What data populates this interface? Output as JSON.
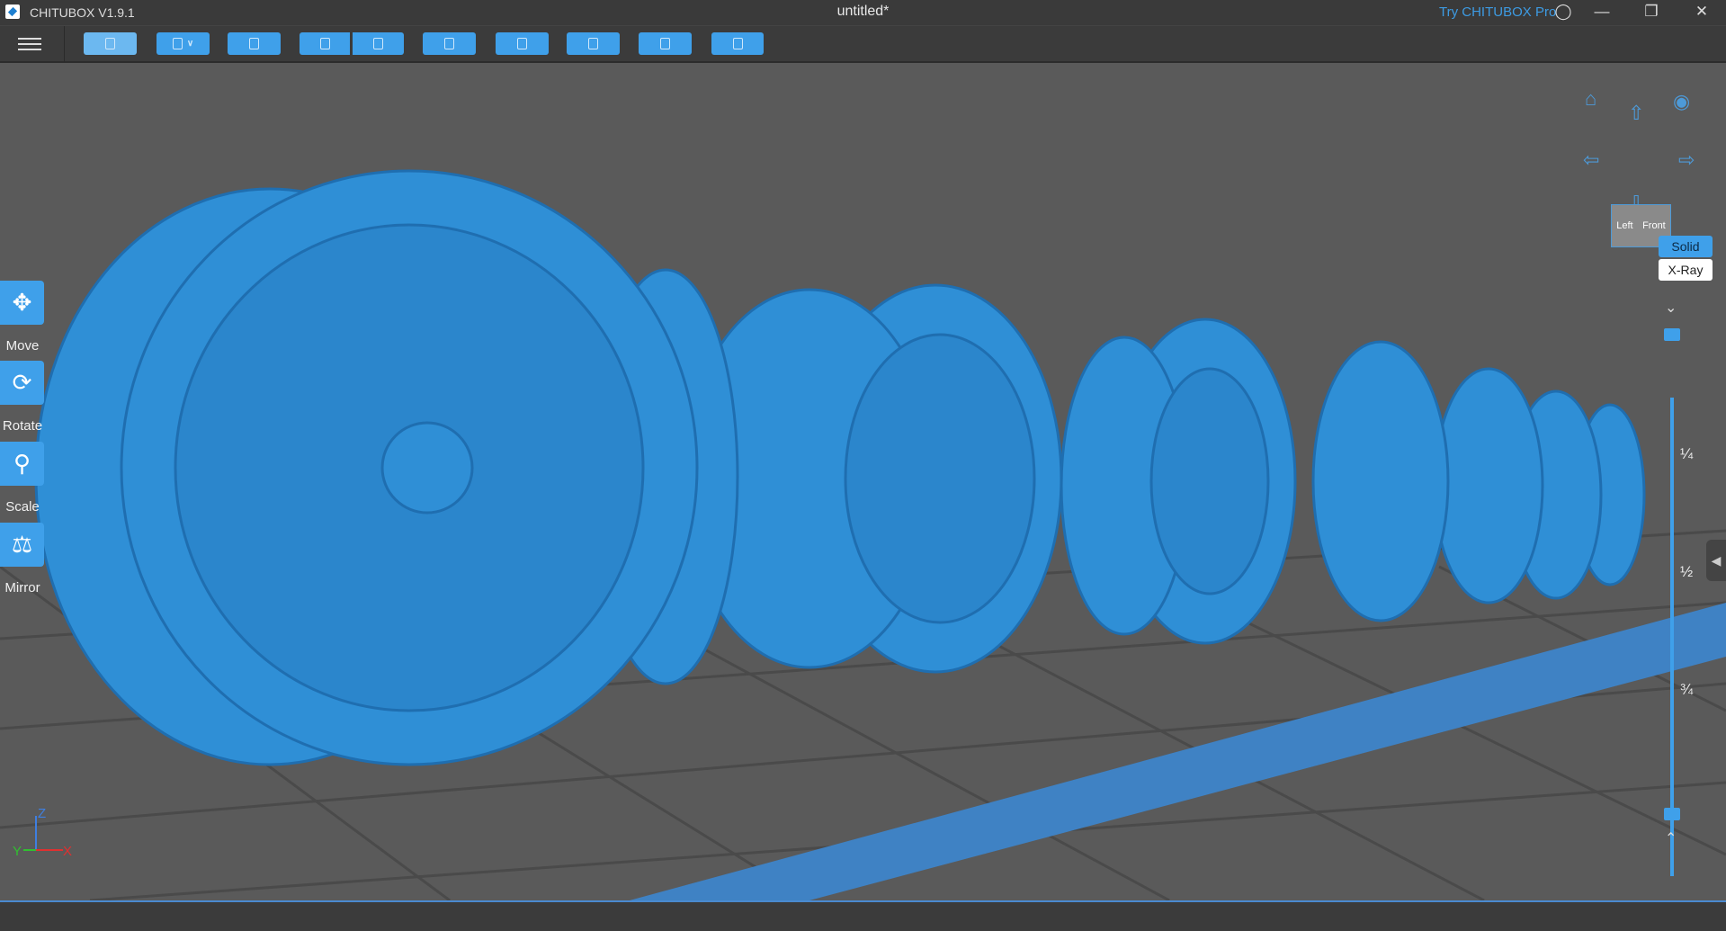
{
  "titlebar": {
    "app_name": "CHITUBOX V1.9.1",
    "document_title": "untitled*",
    "try_pro": "Try CHITUBOX Pro"
  },
  "toolbar": {
    "buttons": [
      "open-file",
      "save",
      "auto-layout",
      "undo",
      "redo",
      "settings",
      "hollow",
      "support",
      "slice",
      "export"
    ]
  },
  "tools": [
    {
      "label": "Move"
    },
    {
      "label": "Rotate"
    },
    {
      "label": "Scale"
    },
    {
      "label": "Mirror"
    }
  ],
  "view_cube": {
    "left": "Left",
    "front": "Front"
  },
  "render_modes": {
    "solid": "Solid",
    "xray": "X-Ray",
    "active": "Solid"
  },
  "layer_slider": {
    "marks": [
      "¼",
      "½",
      "¾"
    ],
    "top_value": 1.0,
    "bottom_value": 0.0
  },
  "axes": {
    "z": "Z",
    "y": "Y",
    "x": "X"
  },
  "colors": {
    "accent": "#3fa0ea",
    "model": "#2f8fd6"
  }
}
